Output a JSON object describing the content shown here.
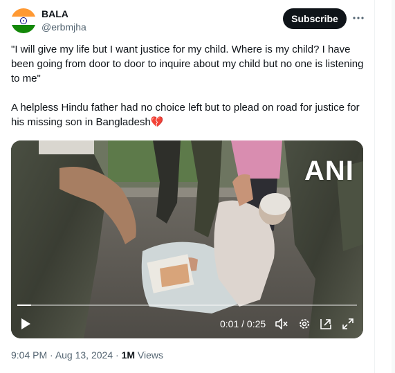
{
  "author": {
    "display_name": "BALA",
    "handle": "@erbmjha",
    "avatar_icon": "india-flag-avatar"
  },
  "header": {
    "subscribe_label": "Subscribe",
    "more_icon": "more-horizontal-icon"
  },
  "tweet": {
    "paragraph_1": "\"I will give my life but I want justice for my child. Where is my child? I have been going from door to door to inquire about my child but no one is listening to me\"",
    "paragraph_2": "A helpless Hindu father had no choice left but to plead on road for justice for his missing son in Bangladesh",
    "emoji": "💔"
  },
  "video": {
    "watermark": "ANI",
    "current_time": "0:01",
    "separator": " / ",
    "duration": "0:25",
    "progress_fraction": 0.04,
    "controls": [
      "play-icon",
      "mute-icon",
      "settings-icon",
      "pip-icon",
      "fullscreen-icon"
    ]
  },
  "meta": {
    "time": "9:04 PM",
    "dot": " · ",
    "date": "Aug 13, 2024",
    "views_count": "1M",
    "views_label": " Views"
  }
}
